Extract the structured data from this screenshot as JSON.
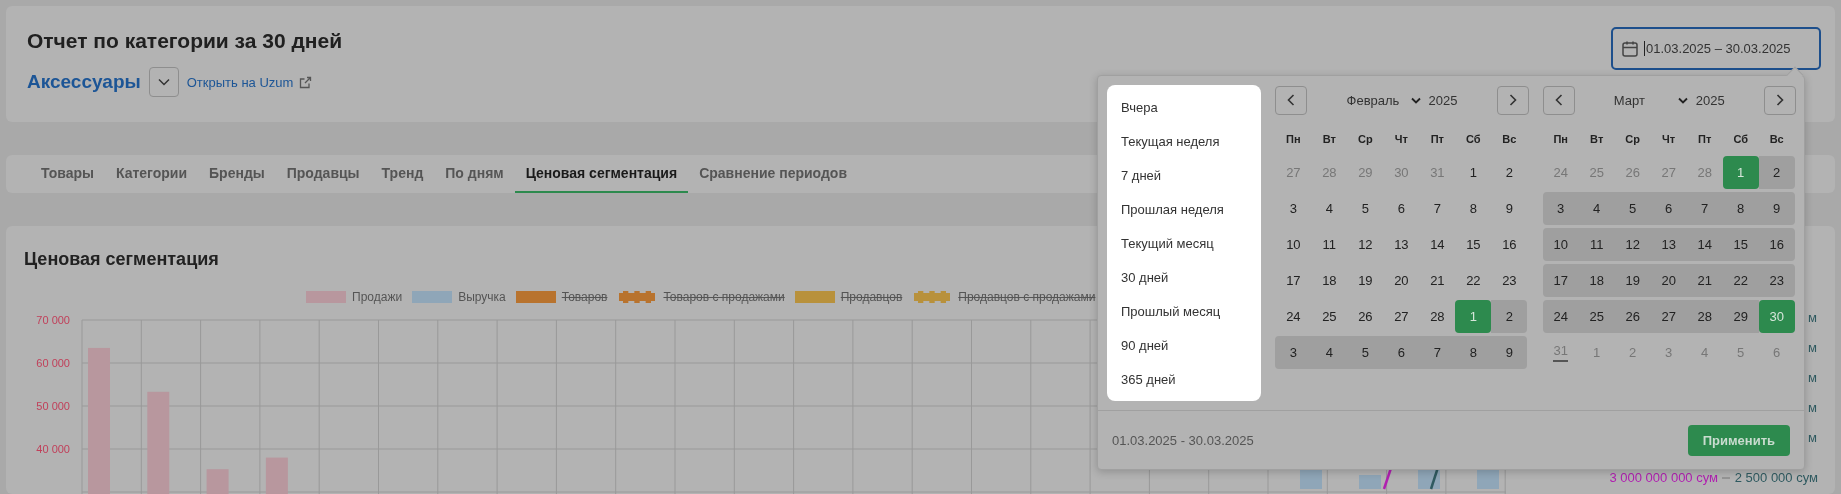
{
  "header": {
    "title": "Отчет по категории за 30 дней",
    "category": "Аксессуары",
    "open_link": "Открыть на Uzum",
    "date_range": {
      "value": "01.03.2025 – 30.03.2025",
      "focused": true
    }
  },
  "tabs": [
    {
      "label": "Товары",
      "selected": false
    },
    {
      "label": "Категории",
      "selected": false
    },
    {
      "label": "Бренды",
      "selected": false
    },
    {
      "label": "Продавцы",
      "selected": false
    },
    {
      "label": "Тренд",
      "selected": false
    },
    {
      "label": "По дням",
      "selected": false
    },
    {
      "label": "Ценовая сегментация",
      "selected": true
    },
    {
      "label": "Сравнение периодов",
      "selected": false
    }
  ],
  "chart_panel": {
    "title": "Ценовая сегментация",
    "legend": [
      {
        "color": "#b8979e",
        "kind": "solid",
        "hidden": false
      },
      {
        "label": "Выручка",
        "color": "#8fa6b8",
        "kind": "solid",
        "hidden": false
      },
      {
        "label": "Товаров",
        "color": "#b8732e",
        "kind": "solid",
        "hidden": true
      },
      {
        "label": "Товаров с продажами",
        "color": "#b8732e",
        "kind": "dashed",
        "hidden": true
      },
      {
        "label": "Продавцов",
        "color": "#b8913c",
        "kind": "solid",
        "hidden": true
      },
      {
        "label": "Продавцов с продажами",
        "color": "#b8913c",
        "kind": "dashed",
        "hidden": true
      }
    ],
    "chart_data": {
      "type": "bar",
      "grid": true,
      "ylim": [
        0,
        70000
      ],
      "series": [
        {
          "name": "Продажи",
          "color": "#b8979e",
          "values": [
            63500,
            53300,
            35300,
            38000
          ]
        }
      ],
      "yticks": [
        {
          "value": 70000,
          "label": "70 000"
        },
        {
          "value": 60000,
          "label": "60 000"
        },
        {
          "value": 50000,
          "label": "50 000"
        },
        {
          "value": 40000,
          "label": "40 000"
        }
      ]
    },
    "right_axis_labels": [
      {
        "text": "3 000 000 000 сум",
        "color": "#b020b0"
      },
      {
        "text": "2 500 000 сум",
        "color": "#2f5a60"
      }
    ],
    "cut_labels": [
      "м",
      "м",
      "м",
      "м",
      "м"
    ]
  },
  "date_picker": {
    "presets": [
      "Вчера",
      "Текущая неделя",
      "7 дней",
      "Прошлая неделя",
      "Текущий месяц",
      "30 дней",
      "Прошлый месяц",
      "90 дней",
      "365 дней"
    ],
    "calendars": [
      {
        "month": "Февраль",
        "year": "2025",
        "weekdays": [
          "Пн",
          "Вт",
          "Ср",
          "Чт",
          "Пт",
          "Сб",
          "Вс"
        ],
        "weeks": [
          [
            {
              "d": "27",
              "muted": true,
              "in_range": false,
              "selected": false,
              "today": false
            },
            {
              "d": "28",
              "muted": true,
              "in_range": false,
              "selected": false,
              "today": false
            },
            {
              "d": "29",
              "muted": true,
              "in_range": false,
              "selected": false,
              "today": false
            },
            {
              "d": "30",
              "muted": true,
              "in_range": false,
              "selected": false,
              "today": false
            },
            {
              "d": "31",
              "muted": true,
              "in_range": false,
              "selected": false,
              "today": false
            },
            {
              "d": "1",
              "muted": false,
              "in_range": false,
              "selected": false,
              "today": false
            },
            {
              "d": "2",
              "muted": false,
              "in_range": false,
              "selected": false,
              "today": false
            }
          ],
          [
            {
              "d": "3",
              "muted": false,
              "in_range": false,
              "selected": false,
              "today": false
            },
            {
              "d": "4",
              "muted": false,
              "in_range": false,
              "selected": false,
              "today": false
            },
            {
              "d": "5",
              "muted": false,
              "in_range": false,
              "selected": false,
              "today": false
            },
            {
              "d": "6",
              "muted": false,
              "in_range": false,
              "selected": false,
              "today": false
            },
            {
              "d": "7",
              "muted": false,
              "in_range": false,
              "selected": false,
              "today": false
            },
            {
              "d": "8",
              "muted": false,
              "in_range": false,
              "selected": false,
              "today": false
            },
            {
              "d": "9",
              "muted": false,
              "in_range": false,
              "selected": false,
              "today": false
            }
          ],
          [
            {
              "d": "10",
              "muted": false,
              "in_range": false,
              "selected": false,
              "today": false
            },
            {
              "d": "11",
              "muted": false,
              "in_range": false,
              "selected": false,
              "today": false
            },
            {
              "d": "12",
              "muted": false,
              "in_range": false,
              "selected": false,
              "today": false
            },
            {
              "d": "13",
              "muted": false,
              "in_range": false,
              "selected": false,
              "today": false
            },
            {
              "d": "14",
              "muted": false,
              "in_range": false,
              "selected": false,
              "today": false
            },
            {
              "d": "15",
              "muted": false,
              "in_range": false,
              "selected": false,
              "today": false
            },
            {
              "d": "16",
              "muted": false,
              "in_range": false,
              "selected": false,
              "today": false
            }
          ],
          [
            {
              "d": "17",
              "muted": false,
              "in_range": false,
              "selected": false,
              "today": false
            },
            {
              "d": "18",
              "muted": false,
              "in_range": false,
              "selected": false,
              "today": false
            },
            {
              "d": "19",
              "muted": false,
              "in_range": false,
              "selected": false,
              "today": false
            },
            {
              "d": "20",
              "muted": false,
              "in_range": false,
              "selected": false,
              "today": false
            },
            {
              "d": "21",
              "muted": false,
              "in_range": false,
              "selected": false,
              "today": false
            },
            {
              "d": "22",
              "muted": false,
              "in_range": false,
              "selected": false,
              "today": false
            },
            {
              "d": "23",
              "muted": false,
              "in_range": false,
              "selected": false,
              "today": false
            }
          ],
          [
            {
              "d": "24",
              "muted": false,
              "in_range": false,
              "selected": false,
              "today": false
            },
            {
              "d": "25",
              "muted": false,
              "in_range": false,
              "selected": false,
              "today": false
            },
            {
              "d": "26",
              "muted": false,
              "in_range": false,
              "selected": false,
              "today": false
            },
            {
              "d": "27",
              "muted": false,
              "in_range": false,
              "selected": false,
              "today": false
            },
            {
              "d": "28",
              "muted": false,
              "in_range": false,
              "selected": false,
              "today": false
            },
            {
              "d": "1",
              "muted": false,
              "in_range": true,
              "selected": true,
              "today": false
            },
            {
              "d": "2",
              "muted": false,
              "in_range": true,
              "selected": false,
              "today": false
            }
          ],
          [
            {
              "d": "3",
              "muted": false,
              "in_range": true,
              "selected": false,
              "today": false
            },
            {
              "d": "4",
              "muted": false,
              "in_range": true,
              "selected": false,
              "today": false
            },
            {
              "d": "5",
              "muted": false,
              "in_range": true,
              "selected": false,
              "today": false
            },
            {
              "d": "6",
              "muted": false,
              "in_range": true,
              "selected": false,
              "today": false
            },
            {
              "d": "7",
              "muted": false,
              "in_range": true,
              "selected": false,
              "today": false
            },
            {
              "d": "8",
              "muted": false,
              "in_range": true,
              "selected": false,
              "today": false
            },
            {
              "d": "9",
              "muted": false,
              "in_range": true,
              "selected": false,
              "today": false
            }
          ]
        ]
      },
      {
        "month": "Март",
        "year": "2025",
        "weekdays": [
          "Пн",
          "Вт",
          "Ср",
          "Чт",
          "Пт",
          "Сб",
          "Вс"
        ],
        "weeks": [
          [
            {
              "d": "24",
              "muted": true,
              "in_range": false,
              "selected": false,
              "today": false
            },
            {
              "d": "25",
              "muted": true,
              "in_range": false,
              "selected": false,
              "today": false
            },
            {
              "d": "26",
              "muted": true,
              "in_range": false,
              "selected": false,
              "today": false
            },
            {
              "d": "27",
              "muted": true,
              "in_range": false,
              "selected": false,
              "today": false
            },
            {
              "d": "28",
              "muted": true,
              "in_range": false,
              "selected": false,
              "today": false
            },
            {
              "d": "1",
              "muted": false,
              "in_range": true,
              "selected": true,
              "today": false
            },
            {
              "d": "2",
              "muted": false,
              "in_range": true,
              "selected": false,
              "today": false
            }
          ],
          [
            {
              "d": "3",
              "muted": false,
              "in_range": true,
              "selected": false,
              "today": false
            },
            {
              "d": "4",
              "muted": false,
              "in_range": true,
              "selected": false,
              "today": false
            },
            {
              "d": "5",
              "muted": false,
              "in_range": true,
              "selected": false,
              "today": false
            },
            {
              "d": "6",
              "muted": false,
              "in_range": true,
              "selected": false,
              "today": false
            },
            {
              "d": "7",
              "muted": false,
              "in_range": true,
              "selected": false,
              "today": false
            },
            {
              "d": "8",
              "muted": false,
              "in_range": true,
              "selected": false,
              "today": false
            },
            {
              "d": "9",
              "muted": false,
              "in_range": true,
              "selected": false,
              "today": false
            }
          ],
          [
            {
              "d": "10",
              "muted": false,
              "in_range": true,
              "selected": false,
              "today": false
            },
            {
              "d": "11",
              "muted": false,
              "in_range": true,
              "selected": false,
              "today": false
            },
            {
              "d": "12",
              "muted": false,
              "in_range": true,
              "selected": false,
              "today": false
            },
            {
              "d": "13",
              "muted": false,
              "in_range": true,
              "selected": false,
              "today": false
            },
            {
              "d": "14",
              "muted": false,
              "in_range": true,
              "selected": false,
              "today": false
            },
            {
              "d": "15",
              "muted": false,
              "in_range": true,
              "selected": false,
              "today": false
            },
            {
              "d": "16",
              "muted": false,
              "in_range": true,
              "selected": false,
              "today": false
            }
          ],
          [
            {
              "d": "17",
              "muted": false,
              "in_range": true,
              "selected": false,
              "today": false
            },
            {
              "d": "18",
              "muted": false,
              "in_range": true,
              "selected": false,
              "today": false
            },
            {
              "d": "19",
              "muted": false,
              "in_range": true,
              "selected": false,
              "today": false
            },
            {
              "d": "20",
              "muted": false,
              "in_range": true,
              "selected": false,
              "today": false
            },
            {
              "d": "21",
              "muted": false,
              "in_range": true,
              "selected": false,
              "today": false
            },
            {
              "d": "22",
              "muted": false,
              "in_range": true,
              "selected": false,
              "today": false
            },
            {
              "d": "23",
              "muted": false,
              "in_range": true,
              "selected": false,
              "today": false
            }
          ],
          [
            {
              "d": "24",
              "muted": false,
              "in_range": true,
              "selected": false,
              "today": false
            },
            {
              "d": "25",
              "muted": false,
              "in_range": true,
              "selected": false,
              "today": false
            },
            {
              "d": "26",
              "muted": false,
              "in_range": true,
              "selected": false,
              "today": false
            },
            {
              "d": "27",
              "muted": false,
              "in_range": true,
              "selected": false,
              "today": false
            },
            {
              "d": "28",
              "muted": false,
              "in_range": true,
              "selected": false,
              "today": false
            },
            {
              "d": "29",
              "muted": false,
              "in_range": true,
              "selected": false,
              "today": false
            },
            {
              "d": "30",
              "muted": false,
              "in_range": true,
              "selected": true,
              "today": false
            }
          ],
          [
            {
              "d": "31",
              "muted": true,
              "in_range": false,
              "selected": false,
              "today": true
            },
            {
              "d": "1",
              "muted": true,
              "in_range": false,
              "selected": false,
              "today": false
            },
            {
              "d": "2",
              "muted": true,
              "in_range": false,
              "selected": false,
              "today": false
            },
            {
              "d": "3",
              "muted": true,
              "in_range": false,
              "selected": false,
              "today": false
            },
            {
              "d": "4",
              "muted": true,
              "in_range": false,
              "selected": false,
              "today": false
            },
            {
              "d": "5",
              "muted": true,
              "in_range": false,
              "selected": false,
              "today": false
            },
            {
              "d": "6",
              "muted": true,
              "in_range": false,
              "selected": false,
              "today": false
            }
          ]
        ]
      }
    ],
    "summary": "01.03.2025 - 30.03.2025",
    "apply": "Применить"
  }
}
